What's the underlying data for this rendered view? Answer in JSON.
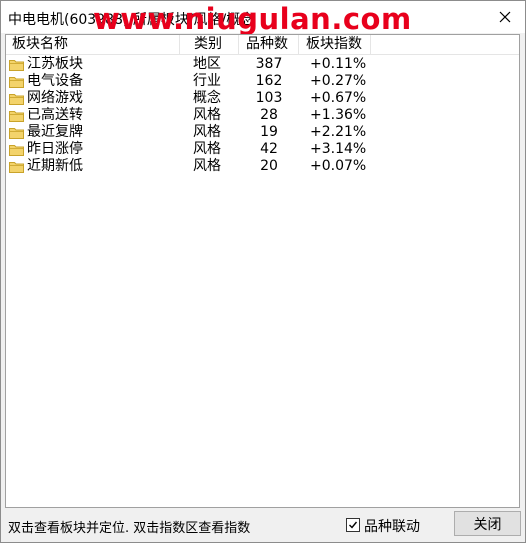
{
  "window": {
    "title": "中电电机(603988) 所属板块/风格/概念",
    "watermark": "www.niugulan.com"
  },
  "table": {
    "headers": [
      "板块名称",
      "类别",
      "品种数",
      "板块指数"
    ],
    "rows": [
      {
        "name": "江苏板块",
        "category": "地区",
        "count": "387",
        "index": "+0.11%"
      },
      {
        "name": "电气设备",
        "category": "行业",
        "count": "162",
        "index": "+0.27%"
      },
      {
        "name": "网络游戏",
        "category": "概念",
        "count": "103",
        "index": "+0.67%"
      },
      {
        "name": "已高送转",
        "category": "风格",
        "count": "28",
        "index": "+1.36%"
      },
      {
        "name": "最近复牌",
        "category": "风格",
        "count": "19",
        "index": "+2.21%"
      },
      {
        "name": "昨日涨停",
        "category": "风格",
        "count": "42",
        "index": "+3.14%"
      },
      {
        "name": "近期新低",
        "category": "风格",
        "count": "20",
        "index": "+0.07%"
      }
    ]
  },
  "status": {
    "hint": "双击查看板块并定位. 双击指数区查看指数",
    "checkbox_label": "品种联动",
    "checkbox_checked": true,
    "close_button": "关闭"
  },
  "icons": {
    "folder": "folder-icon",
    "close": "close-icon",
    "check": "check-icon"
  },
  "colors": {
    "watermark": "#e8001c",
    "folder_fill": "#f3d36b",
    "folder_stroke": "#c9a32a"
  }
}
